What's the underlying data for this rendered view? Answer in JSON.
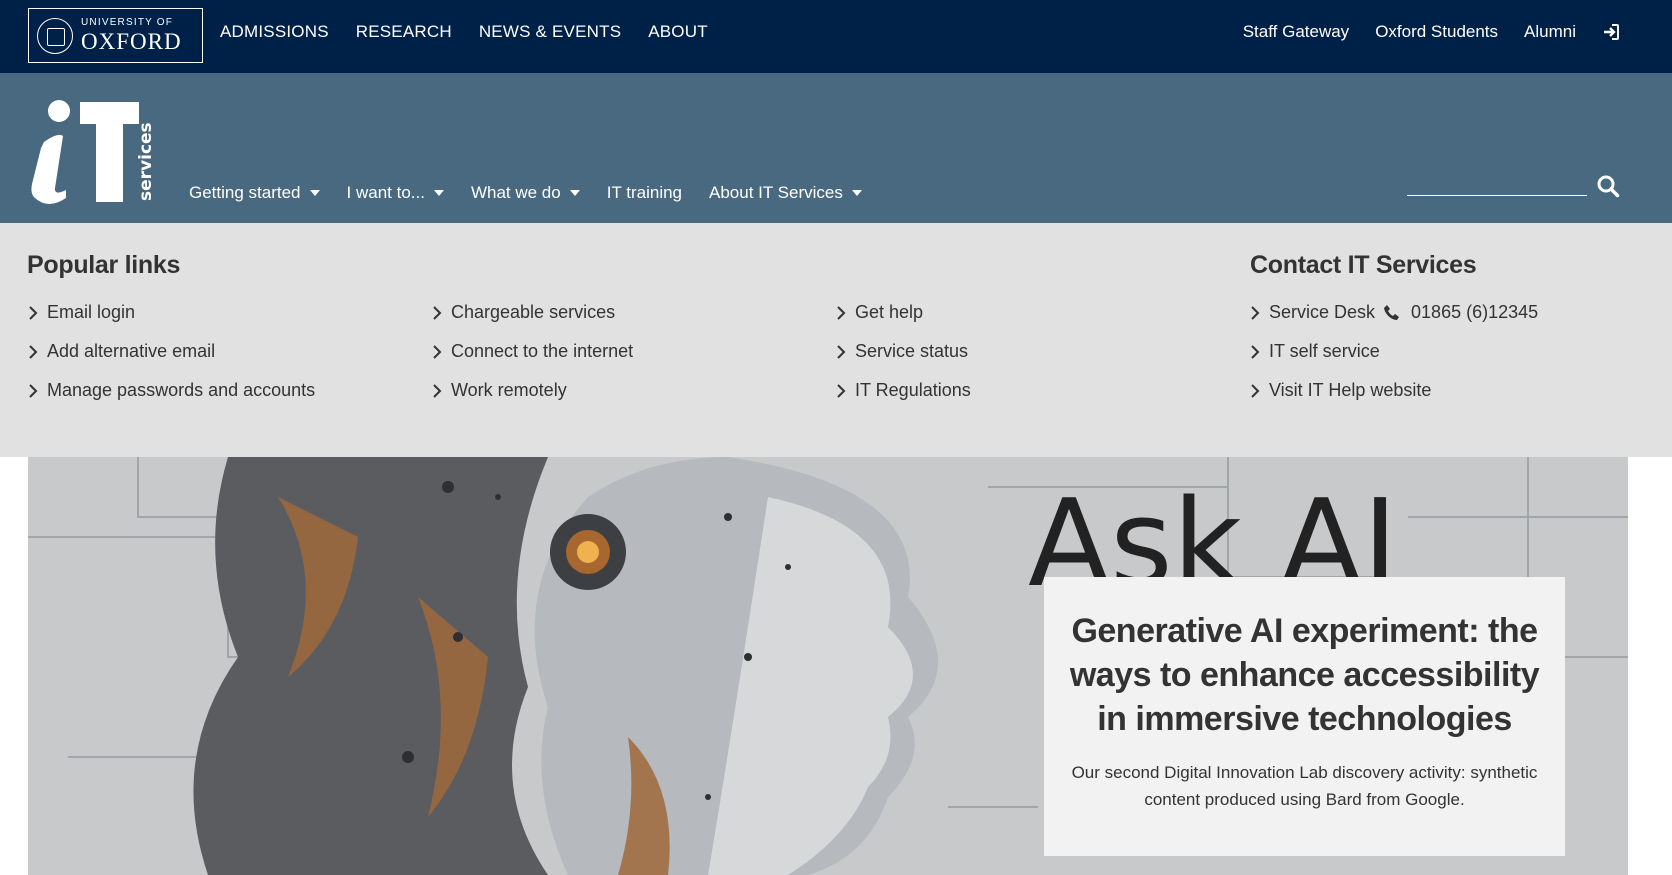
{
  "university": {
    "logo_small": "UNIVERSITY OF",
    "logo_big": "OXFORD",
    "nav": [
      "ADMISSIONS",
      "RESEARCH",
      "NEWS & EVENTS",
      "ABOUT"
    ],
    "links": [
      "Staff Gateway",
      "Oxford Students",
      "Alumni"
    ]
  },
  "it_header": {
    "logo_letters": "iT",
    "logo_word": "services",
    "nav": [
      {
        "label": "Getting started",
        "dropdown": true
      },
      {
        "label": "I want to...",
        "dropdown": true
      },
      {
        "label": "What we do",
        "dropdown": true
      },
      {
        "label": "IT training",
        "dropdown": false
      },
      {
        "label": "About IT Services",
        "dropdown": true
      }
    ],
    "search_placeholder": "",
    "search_value": ""
  },
  "popular_links": {
    "heading": "Popular links",
    "columns": [
      [
        "Email login",
        "Add alternative email",
        "Manage passwords and accounts"
      ],
      [
        "Chargeable services",
        "Connect to the internet",
        "Work remotely"
      ],
      [
        "Get help",
        "Service status",
        "IT Regulations"
      ]
    ]
  },
  "contact": {
    "heading": "Contact IT Services",
    "service_desk_label": "Service Desk",
    "service_desk_phone": "01865 (6)12345",
    "links": [
      "IT self service",
      "Visit IT Help website"
    ]
  },
  "hero": {
    "image_text": "Ask AI",
    "title": "Generative AI experiment: the ways to enhance accessibility in immersive technologies",
    "description": "Our second Digital Innovation Lab discovery activity: synthetic content produced using Bard from Google."
  },
  "colors": {
    "oxford_blue": "#002147",
    "it_header": "#48697f",
    "panel": "#e1e1e1",
    "card": "#f2f2f2"
  }
}
